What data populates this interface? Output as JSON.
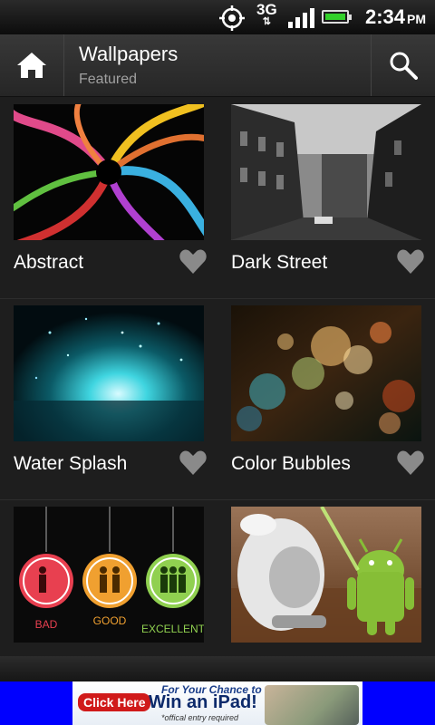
{
  "status_bar": {
    "network": "3G",
    "time": "2:34",
    "ampm": "PM"
  },
  "action_bar": {
    "title": "Wallpapers",
    "subtitle": "Featured"
  },
  "wallpapers": [
    {
      "name": "Abstract",
      "favorited": false
    },
    {
      "name": "Dark Street",
      "favorited": false
    },
    {
      "name": "Water Splash",
      "favorited": false
    },
    {
      "name": "Color Bubbles",
      "favorited": false
    },
    {
      "name": "",
      "thumb_labels": [
        "BAD",
        "GOOD",
        "EXCELLENT"
      ],
      "favorited": false
    },
    {
      "name": "",
      "favorited": false
    }
  ],
  "ad": {
    "button": "Click Here",
    "line1": "For Your Chance to",
    "line2": "Win an iPad!",
    "line3": "*offical entry required"
  },
  "colors": {
    "ad_background": "#0000ff",
    "heart": "#8a8a8a",
    "battery": "#32d12a"
  }
}
